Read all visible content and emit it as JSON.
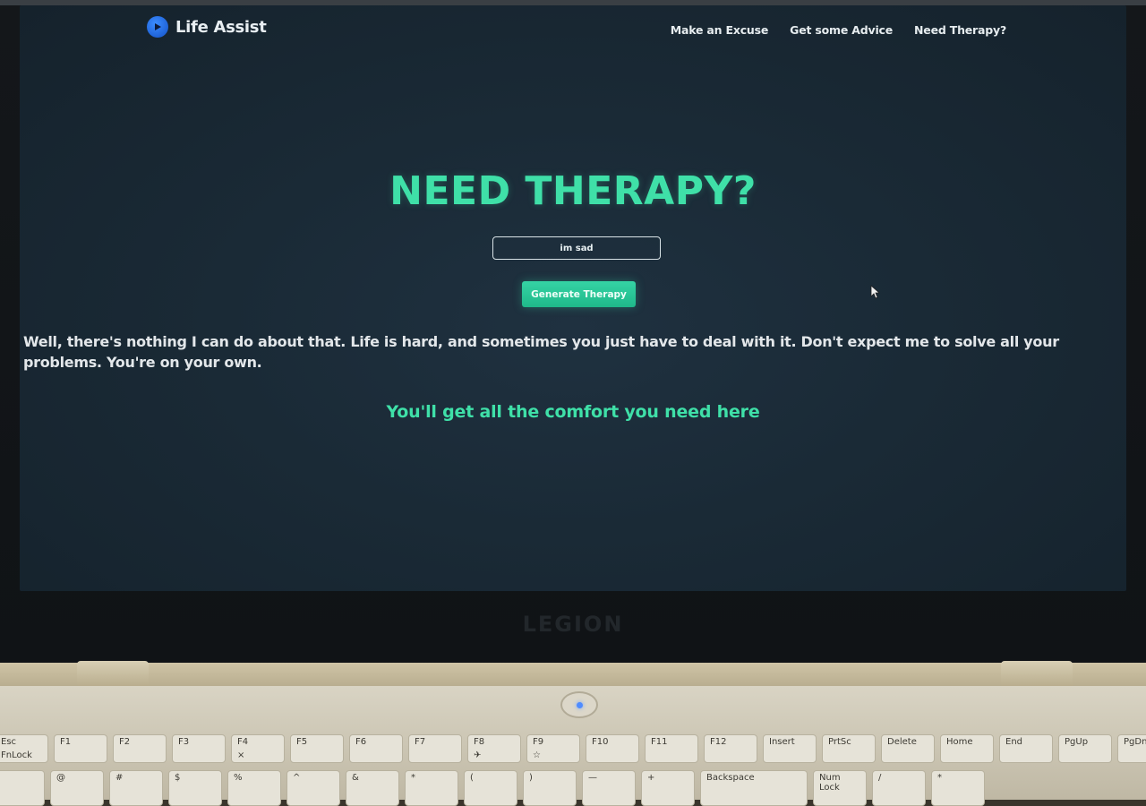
{
  "brand": {
    "name": "Life Assist",
    "icon": "play-circle-icon",
    "color": "#1f63d8"
  },
  "nav": [
    {
      "label": "Make an Excuse"
    },
    {
      "label": "Get some Advice"
    },
    {
      "label": "Need Therapy?"
    }
  ],
  "hero": {
    "title": "NEED THERAPY?",
    "input_value": "im sad",
    "button_label": "Generate Therapy",
    "accent": "#3fe0a8"
  },
  "response": "Well, there's nothing I can do about that. Life is hard, and sometimes you just have to deal with it. Don't expect me to solve all your problems. You're on your own.",
  "tagline": "You'll get all the comfort you need here",
  "laptop_logo": "LEGION",
  "keyboard": {
    "function_row": [
      {
        "label": "Esc",
        "sub": "FnLock"
      },
      {
        "label": "F1",
        "sub": ""
      },
      {
        "label": "F2",
        "sub": ""
      },
      {
        "label": "F3",
        "sub": ""
      },
      {
        "label": "F4",
        "sub": "×"
      },
      {
        "label": "F5",
        "sub": ""
      },
      {
        "label": "F6",
        "sub": ""
      },
      {
        "label": "F7",
        "sub": ""
      },
      {
        "label": "F8",
        "sub": "✈"
      },
      {
        "label": "F9",
        "sub": "☆"
      },
      {
        "label": "F10",
        "sub": ""
      },
      {
        "label": "F11",
        "sub": ""
      },
      {
        "label": "F12",
        "sub": ""
      },
      {
        "label": "Insert",
        "sub": ""
      },
      {
        "label": "PrtSc",
        "sub": ""
      },
      {
        "label": "Delete",
        "sub": ""
      },
      {
        "label": "Home",
        "sub": ""
      },
      {
        "label": "End",
        "sub": ""
      },
      {
        "label": "PgUp",
        "sub": ""
      },
      {
        "label": "PgDn",
        "sub": ""
      }
    ],
    "number_row": [
      {
        "label": "!"
      },
      {
        "label": "@"
      },
      {
        "label": "#"
      },
      {
        "label": "$"
      },
      {
        "label": "%"
      },
      {
        "label": "^"
      },
      {
        "label": "&"
      },
      {
        "label": "*"
      },
      {
        "label": "("
      },
      {
        "label": ")"
      },
      {
        "label": "—"
      },
      {
        "label": "+"
      },
      {
        "label": "Backspace"
      },
      {
        "label": "Num Lock"
      },
      {
        "label": "/"
      },
      {
        "label": "*"
      }
    ]
  }
}
